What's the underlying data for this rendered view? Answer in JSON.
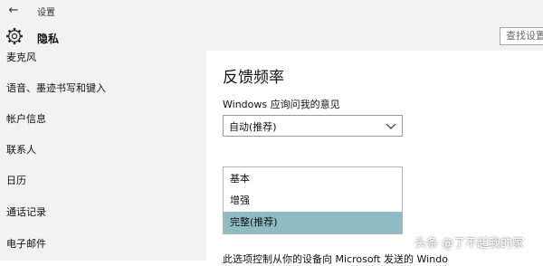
{
  "window": {
    "title": "设置",
    "back_icon": "arrow-left-icon",
    "back_glyph": "←"
  },
  "header": {
    "icon": "gear-icon",
    "title": "隐私",
    "search_placeholder": "查找设置"
  },
  "sidebar": {
    "items": [
      {
        "label": "麦克风"
      },
      {
        "label": "语音、墨迹书写和键入"
      },
      {
        "label": "帐户信息"
      },
      {
        "label": "联系人"
      },
      {
        "label": "日历"
      },
      {
        "label": "通话记录"
      },
      {
        "label": "电子邮件"
      }
    ]
  },
  "main": {
    "section_title": "反馈频率",
    "field_label": "Windows 应询问我的意见",
    "dropdown_value": "自动(推荐)",
    "dropdown_icon": "chevron-down-icon",
    "options": [
      {
        "label": "基本",
        "selected": false
      },
      {
        "label": "增强",
        "selected": false
      },
      {
        "label": "完整(推荐)",
        "selected": true
      }
    ],
    "description_partial": "此选项控制从你的设备向 Microsoft 发送的 Windo"
  },
  "watermark": "头条 @了不起我的家",
  "colors": {
    "sidebar_bg": "#f2f2f2",
    "selected_option_bg": "#8fbcc3",
    "content_bg": "#ffffff"
  }
}
